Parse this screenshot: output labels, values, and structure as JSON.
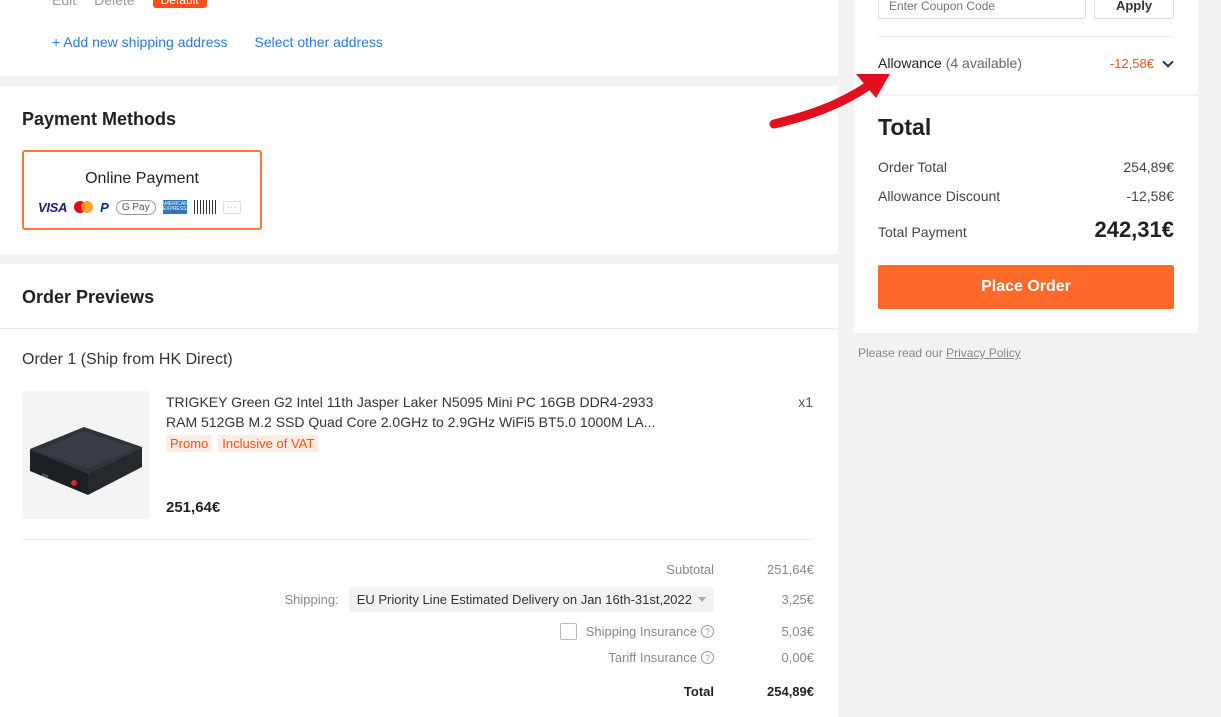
{
  "address": {
    "edit_label": "Edit",
    "delete_label": "Delete",
    "default_badge": "Default",
    "add_new_label": "+ Add new shipping address",
    "select_other_label": "Select other address"
  },
  "payment": {
    "title": "Payment Methods",
    "card_title": "Online Payment",
    "logos": [
      "visa-logo",
      "mastercard-logo",
      "paypal-logo",
      "google-pay-logo",
      "amex-logo",
      "boleto-logo",
      "more-icon"
    ],
    "visa_text": "VISA",
    "paypal_text": "P",
    "gpay_text": "G Pay",
    "amex_text": "AMERICAN EXPRESS",
    "more_text": "···"
  },
  "order": {
    "title": "Order Previews",
    "ship_from": "Order 1 (Ship from HK Direct)",
    "product_name": "TRIGKEY Green G2 Intel 11th Jasper Laker N5095 Mini PC 16GB DDR4-2933 RAM 512GB M.2 SSD Quad Core 2.0GHz to 2.9GHz WiFi5 BT5.0 1000M LA...",
    "quantity": "x1",
    "tags": [
      "Promo",
      "Inclusive of VAT"
    ],
    "price": "251,64€",
    "subtotal_label": "Subtotal",
    "subtotal_value": "251,64€",
    "shipping_label": "Shipping:",
    "shipping_method": "EU Priority Line Estimated Delivery on Jan 16th-31st,2022",
    "shipping_value": "3,25€",
    "insurance_label": "Shipping Insurance",
    "insurance_value": "5,03€",
    "tariff_label": "Tariff Insurance",
    "tariff_value": "0,00€",
    "total_label": "Total",
    "total_value": "254,89€"
  },
  "summary": {
    "coupon_placeholder": "Enter Coupon Code",
    "apply_label": "Apply",
    "allowance_label": "Allowance",
    "allowance_available": "(4 available)",
    "allowance_amount": "-12,58€",
    "total_title": "Total",
    "order_total_label": "Order Total",
    "order_total_value": "254,89€",
    "allowance_discount_label": "Allowance Discount",
    "allowance_discount_value": "-12,58€",
    "total_payment_label": "Total Payment",
    "total_payment_value": "242,31€",
    "place_order_label": "Place Order",
    "privacy_prefix": "Please read our",
    "privacy_link": "Privacy Policy"
  },
  "colors": {
    "accent": "#ff6a2b",
    "discount": "#f5501e",
    "link": "#2a7ad8",
    "annotation_arrow": "#e0101e"
  }
}
